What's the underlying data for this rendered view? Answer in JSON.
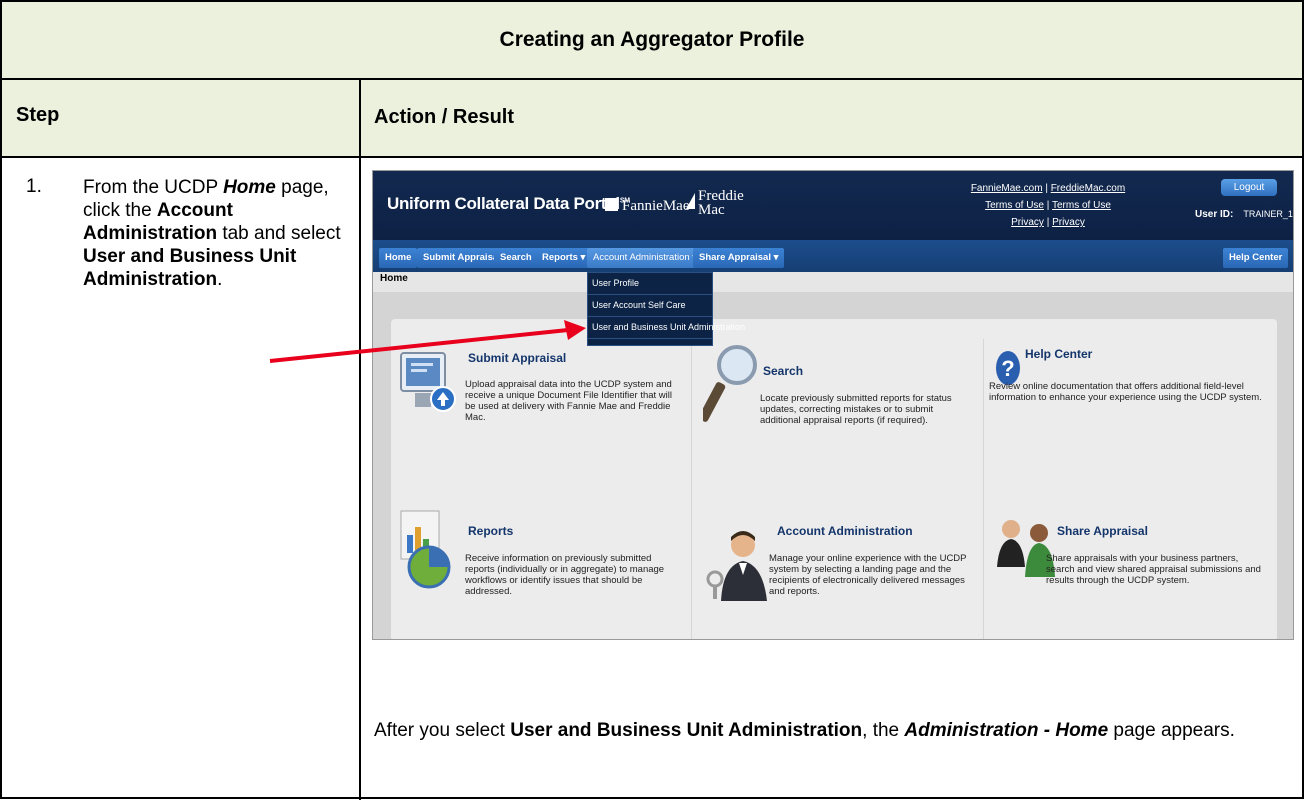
{
  "document": {
    "title": "Creating an Aggregator Profile",
    "col_step": "Step",
    "col_action": "Action / Result",
    "step_number": "1.",
    "step_parts": {
      "a": "From the UCDP ",
      "b": "Home",
      "c": " page, click the ",
      "d": "Account Administration",
      "e": " tab and select ",
      "f": "User and Business Unit Administration",
      "g": "."
    },
    "after_parts": {
      "a": "After you select ",
      "b": "User and Business Unit Administration",
      "c": ", the ",
      "d": "Administration - Home",
      "e": " page appears."
    }
  },
  "screenshot": {
    "portal_name": "Uniform Collateral Data Portal",
    "portal_mark": "SM",
    "fannie_mae": "FannieMae",
    "freddie_line1": "Freddie",
    "freddie_line2": "Mac",
    "links": {
      "fannie_site": "FannieMae.com",
      "freddie_site": "FreddieMac.com",
      "terms1": "Terms of Use",
      "terms2": "Terms of Use",
      "privacy1": "Privacy",
      "privacy2": "Privacy",
      "separator": "|"
    },
    "logout": "Logout",
    "user_id_label": "User ID:",
    "user_id_value": "TRAINER_1",
    "tabs": {
      "home": "Home",
      "submit": "Submit Appraisal",
      "search": "Search",
      "reports": "Reports ▾",
      "account_admin": "Account Administration ▾",
      "share": "Share Appraisal ▾",
      "help": "Help Center"
    },
    "breadcrumb": "Home",
    "dropdown": {
      "item1": "User Profile",
      "item2": "User Account Self Care",
      "item3": "User and Business Unit Administration"
    },
    "cards": {
      "submit_title": "Submit Appraisal",
      "submit_desc": "Upload appraisal data into the UCDP system and receive a unique Document File Identifier that will be used at delivery with Fannie Mae and Freddie Mac.",
      "search_title": "Search",
      "search_desc": "Locate previously submitted reports for status updates, correcting mistakes or to submit additional appraisal reports (if required).",
      "help_title": "Help Center",
      "help_desc": "Review online documentation that offers additional field-level information to enhance your experience using the UCDP system.",
      "reports_title": "Reports",
      "reports_desc": "Receive information on previously submitted reports (individually or in aggregate) to manage workflows or identify issues that should be addressed.",
      "admin_title": "Account Administration",
      "admin_desc": "Manage your online experience with the UCDP system by selecting a landing page and the recipients of electronically delivered messages and reports.",
      "share_title": "Share Appraisal",
      "share_desc": "Share appraisals with your business partners, search and view shared appraisal submissions and results through the UCDP system."
    }
  },
  "colors": {
    "header_fill": "#ebf1dd",
    "portal_bar": "#13294f",
    "tab_blue": "#2a68b6",
    "arrow": "#e8001c"
  }
}
